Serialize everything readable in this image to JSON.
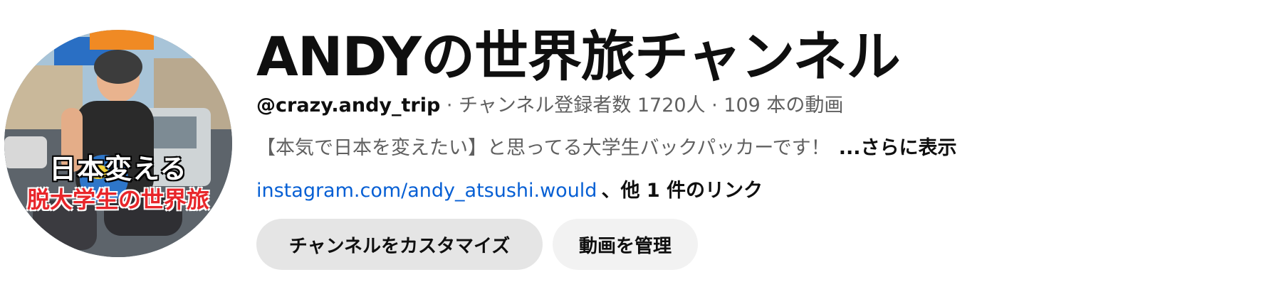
{
  "channel": {
    "name": "ANDYの世界旅チャンネル",
    "handle": "@crazy.andy_trip",
    "meta_rest": " · チャンネル登録者数 1720人 · 109 本の動画",
    "description": "【本気で日本を変えたい】と思ってる大学生バックパッカーです！",
    "more_label": "...さらに表示",
    "link_text": "instagram.com/andy_atsushi.would",
    "other_links": "、他 1 件のリンク"
  },
  "avatar": {
    "line1": "日本変える",
    "line2": "脱大学生の世界旅",
    "colors": {
      "line1": "#ffffff",
      "line2": "#e8262a"
    }
  },
  "buttons": {
    "customize_label": "チャンネルをカスタマイズ",
    "manage_label": "動画を管理"
  },
  "colors": {
    "link": "#065fd4",
    "secondary_text": "#606060",
    "primary_text": "#0f0f0f",
    "button_bg": "#e5e5e5"
  }
}
